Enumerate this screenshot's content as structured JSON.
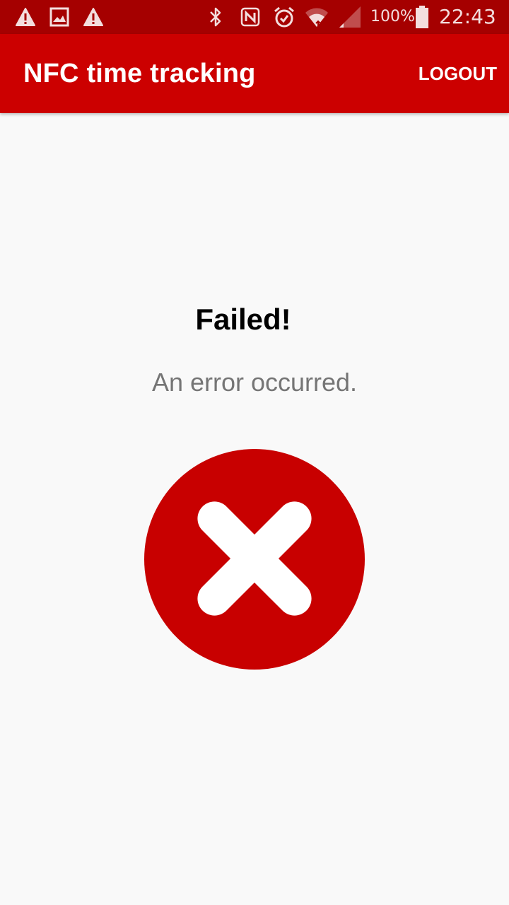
{
  "status_bar": {
    "battery_percent": "100%",
    "time": "22:43",
    "icons": [
      "warning-icon",
      "image-icon",
      "warning-icon",
      "bluetooth-icon",
      "nfc-icon",
      "alarm-icon",
      "wifi-icon",
      "signal-icon",
      "battery-icon"
    ]
  },
  "app_bar": {
    "title": "NFC time tracking",
    "logout_label": "LOGOUT"
  },
  "result": {
    "title": "Failed!",
    "message": "An error occurred.",
    "icon": "error-x-icon"
  },
  "colors": {
    "status_bar": "#a50000",
    "app_bar": "#cc0000",
    "error_circle": "#c80000",
    "background": "#f9f9f9",
    "message_text": "#757575"
  }
}
